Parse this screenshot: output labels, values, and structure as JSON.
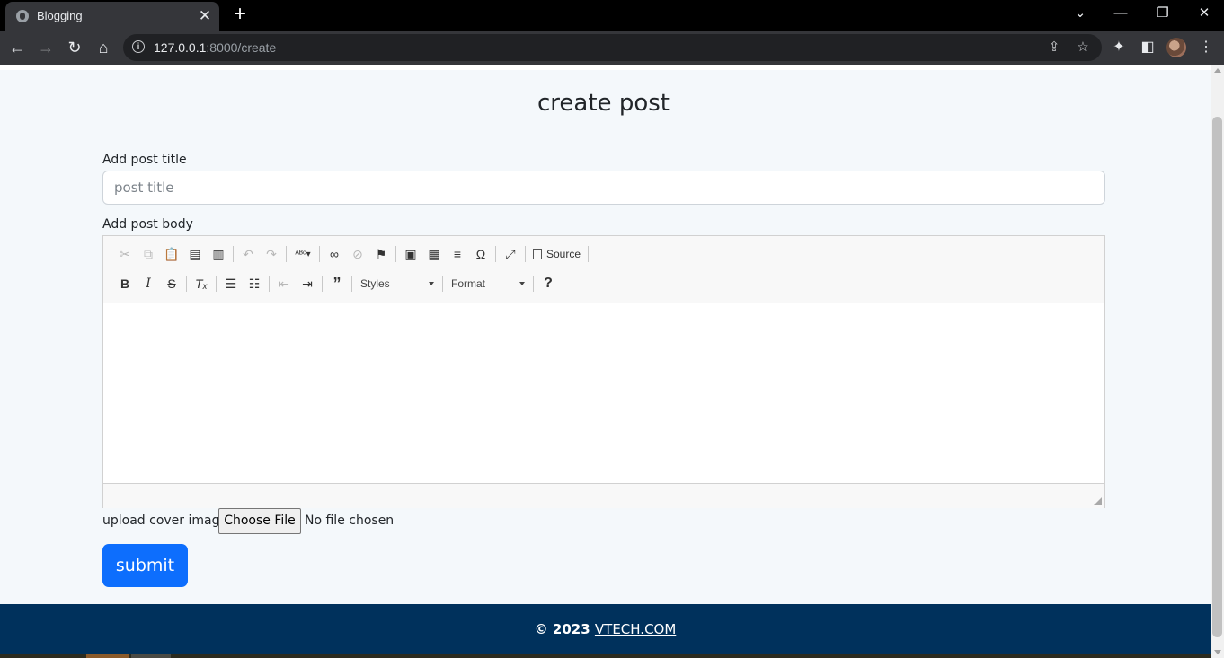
{
  "browser": {
    "tab_title": "Blogging",
    "url_host": "127.0.0.1",
    "url_path": ":8000/create"
  },
  "page": {
    "heading": "create post",
    "title_label": "Add post title",
    "title_placeholder": "post title",
    "body_label": "Add post body",
    "editor": {
      "source_label": "Source",
      "styles_label": "Styles",
      "format_label": "Format",
      "help_label": "?"
    },
    "upload_label": "upload cover image",
    "file_button": "Choose File",
    "file_status": "No file chosen",
    "submit_label": "submit"
  },
  "footer": {
    "copyright": "© 2023",
    "site": "VTECH.COM"
  },
  "colors": {
    "primary": "#0d6efd",
    "footer_bg": "#00315c",
    "page_bg": "#f4f8fb"
  }
}
